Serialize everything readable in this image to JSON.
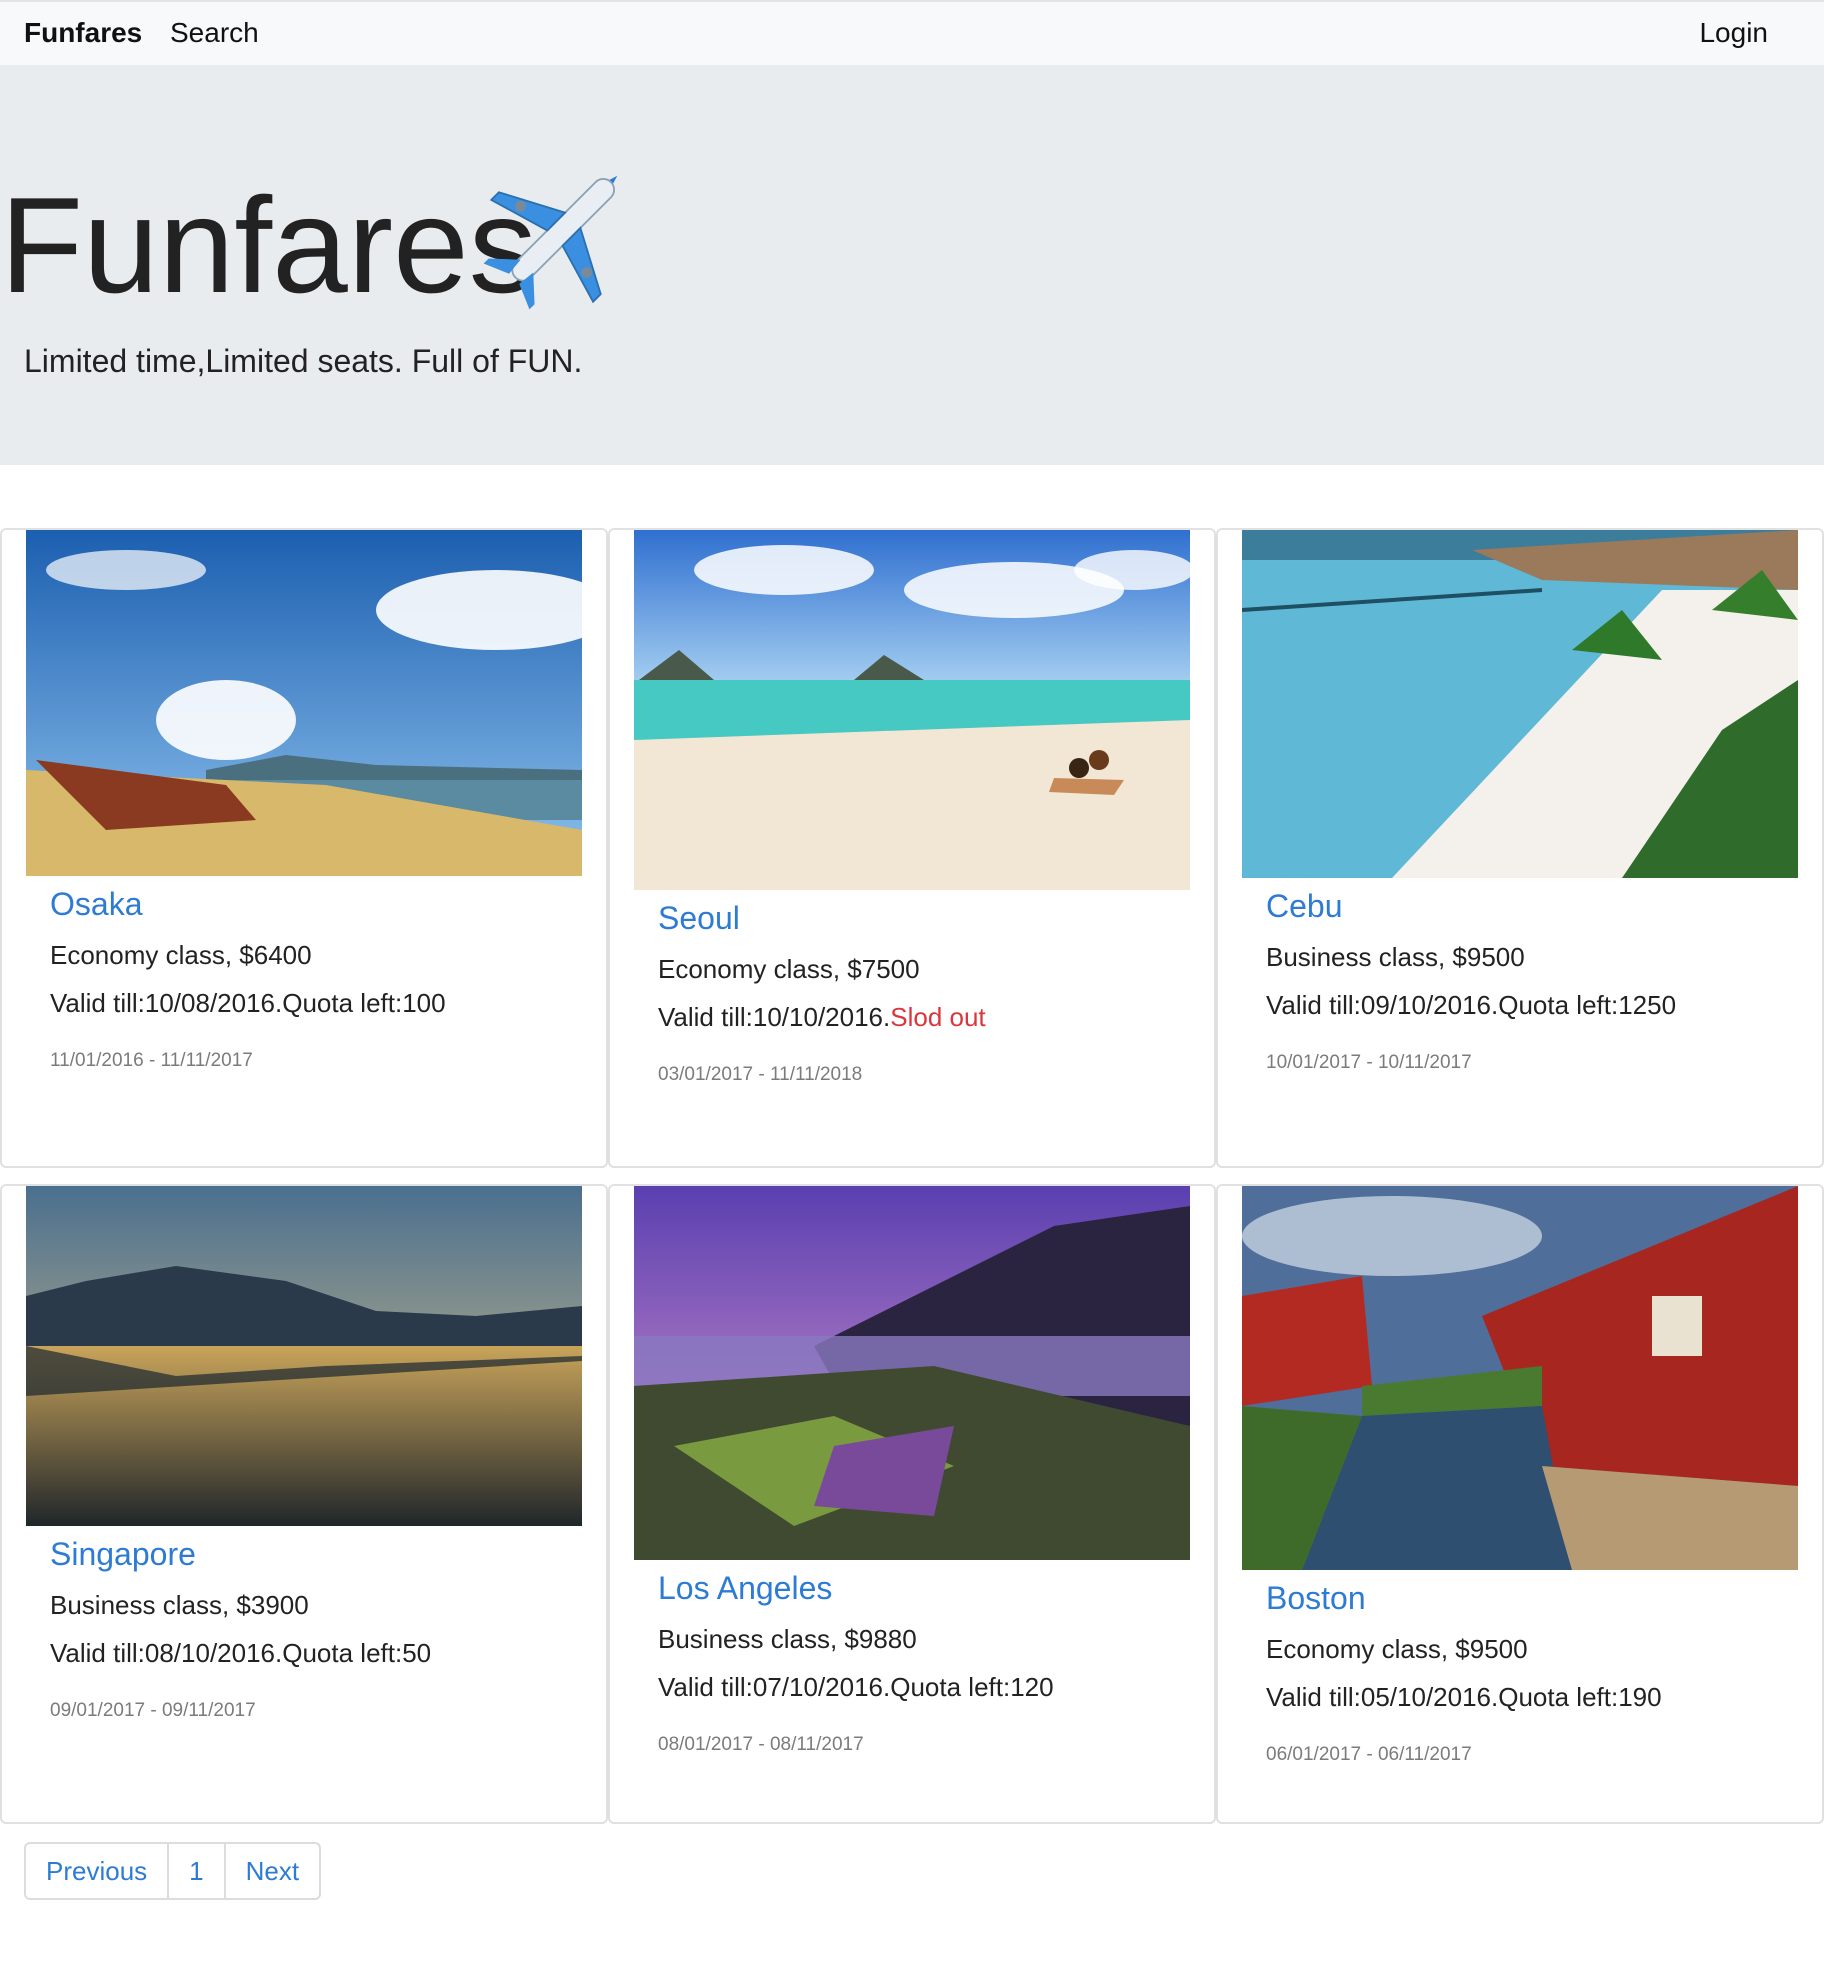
{
  "navbar": {
    "brand": "Funfares",
    "search": "Search",
    "login": "Login"
  },
  "hero": {
    "title": "Funfares",
    "plane_icon": "airplane-icon",
    "subtitle": "Limited time,Limited seats. Full of FUN."
  },
  "cards": [
    {
      "city": "Osaka",
      "class_price": "Economy class, $6400",
      "valid": "Valid till:10/08/2016.Quota left:100",
      "dates": "11/01/2016 - 11/11/2017",
      "image": "beach-boat"
    },
    {
      "city": "Seoul",
      "class_price": "Economy class, $7500",
      "valid": "Valid till:10/10/2016.",
      "status": "Slod out",
      "dates": "03/01/2017 - 11/11/2018",
      "image": "beach-couple"
    },
    {
      "city": "Cebu",
      "class_price": "Business class, $9500",
      "valid": "Valid till:09/10/2016.Quota left:1250",
      "dates": "10/01/2017 - 10/11/2017",
      "image": "tropical-beach"
    },
    {
      "city": "Singapore",
      "class_price": "Business class, $3900",
      "valid": "Valid till:08/10/2016.Quota left:50",
      "dates": "09/01/2017 - 09/11/2017",
      "image": "mountain-lake"
    },
    {
      "city": "Los Angeles",
      "class_price": "Business class, $9880",
      "valid": "Valid till:07/10/2016.Quota left:120",
      "dates": "08/01/2017 - 08/11/2017",
      "image": "purple-coast"
    },
    {
      "city": "Boston",
      "class_price": "Economy class, $9500",
      "valid": "Valid till:05/10/2016.Quota left:190",
      "dates": "06/01/2017 - 06/11/2017",
      "image": "red-houses-canal"
    }
  ],
  "pagination": {
    "previous": "Previous",
    "page": "1",
    "next": "Next"
  },
  "colors": {
    "link": "#2e7bd3",
    "soldout": "#d9363e"
  }
}
